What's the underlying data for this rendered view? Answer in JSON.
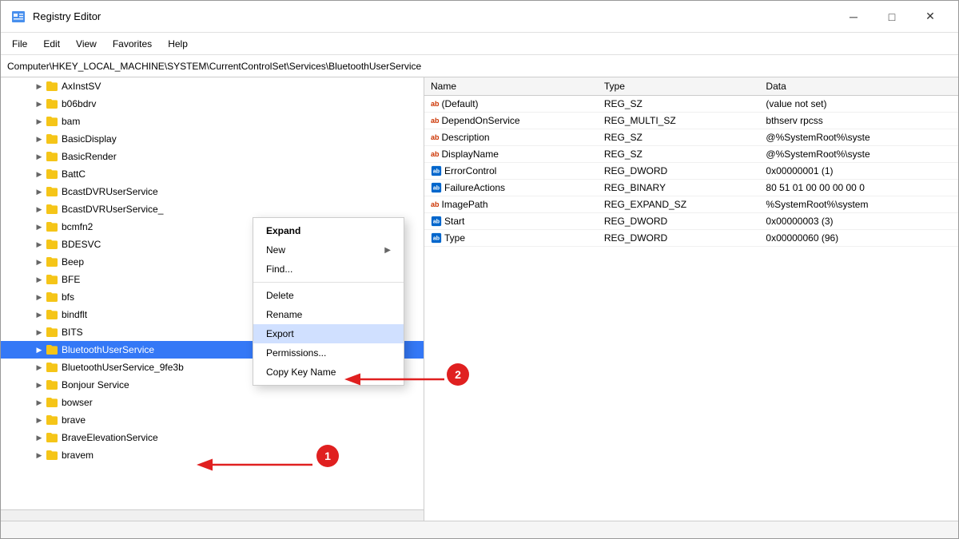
{
  "window": {
    "title": "Registry Editor",
    "app_icon": "🗂"
  },
  "window_controls": {
    "minimize": "─",
    "maximize": "□",
    "close": "✕"
  },
  "menu": {
    "items": [
      "File",
      "Edit",
      "View",
      "Favorites",
      "Help"
    ]
  },
  "address_bar": {
    "path": "Computer\\HKEY_LOCAL_MACHINE\\SYSTEM\\CurrentControlSet\\Services\\BluetoothUserService"
  },
  "tree": {
    "items": [
      {
        "label": "AxInstSV",
        "indent": 1,
        "selected": false
      },
      {
        "label": "b06bdrv",
        "indent": 1,
        "selected": false
      },
      {
        "label": "bam",
        "indent": 1,
        "selected": false
      },
      {
        "label": "BasicDisplay",
        "indent": 1,
        "selected": false
      },
      {
        "label": "BasicRender",
        "indent": 1,
        "selected": false
      },
      {
        "label": "BattC",
        "indent": 1,
        "selected": false
      },
      {
        "label": "BcastDVRUserService",
        "indent": 1,
        "selected": false
      },
      {
        "label": "BcastDVRUserService_",
        "indent": 1,
        "selected": false
      },
      {
        "label": "bcmfn2",
        "indent": 1,
        "selected": false
      },
      {
        "label": "BDESVC",
        "indent": 1,
        "selected": false
      },
      {
        "label": "Beep",
        "indent": 1,
        "selected": false
      },
      {
        "label": "BFE",
        "indent": 1,
        "selected": false
      },
      {
        "label": "bfs",
        "indent": 1,
        "selected": false
      },
      {
        "label": "bindflt",
        "indent": 1,
        "selected": false
      },
      {
        "label": "BITS",
        "indent": 1,
        "selected": false
      },
      {
        "label": "BluetoothUserService",
        "indent": 1,
        "selected": true
      },
      {
        "label": "BluetoothUserService_9fe3b",
        "indent": 1,
        "selected": false
      },
      {
        "label": "Bonjour Service",
        "indent": 1,
        "selected": false
      },
      {
        "label": "bowser",
        "indent": 1,
        "selected": false
      },
      {
        "label": "brave",
        "indent": 1,
        "selected": false
      },
      {
        "label": "BraveElevationService",
        "indent": 1,
        "selected": false
      },
      {
        "label": "bravem",
        "indent": 1,
        "selected": false
      }
    ]
  },
  "context_menu": {
    "items": [
      {
        "label": "Expand",
        "bold": true,
        "has_arrow": false,
        "separator_after": false
      },
      {
        "label": "New",
        "bold": false,
        "has_arrow": true,
        "separator_after": false
      },
      {
        "label": "Find...",
        "bold": false,
        "has_arrow": false,
        "separator_after": true
      },
      {
        "label": "Delete",
        "bold": false,
        "has_arrow": false,
        "separator_after": false
      },
      {
        "label": "Rename",
        "bold": false,
        "has_arrow": false,
        "separator_after": false
      },
      {
        "label": "Export",
        "bold": false,
        "has_arrow": false,
        "separator_after": false,
        "highlighted": true
      },
      {
        "label": "Permissions...",
        "bold": false,
        "has_arrow": false,
        "separator_after": false
      },
      {
        "label": "Copy Key Name",
        "bold": false,
        "has_arrow": false,
        "separator_after": false
      }
    ]
  },
  "registry_table": {
    "columns": [
      "Name",
      "Type",
      "Data"
    ],
    "rows": [
      {
        "icon": "ab",
        "name": "(Default)",
        "type": "REG_SZ",
        "data": "(value not set)"
      },
      {
        "icon": "ab",
        "name": "DependOnService",
        "type": "REG_MULTI_SZ",
        "data": "bthserv rpcss"
      },
      {
        "icon": "ab",
        "name": "Description",
        "type": "REG_SZ",
        "data": "@%SystemRoot%\\syste"
      },
      {
        "icon": "ab",
        "name": "DisplayName",
        "type": "REG_SZ",
        "data": "@%SystemRoot%\\syste"
      },
      {
        "icon": "dword",
        "name": "ErrorControl",
        "type": "REG_DWORD",
        "data": "0x00000001 (1)"
      },
      {
        "icon": "dword",
        "name": "FailureActions",
        "type": "REG_BINARY",
        "data": "80 51 01 00 00 00 00 0"
      },
      {
        "icon": "ab",
        "name": "ImagePath",
        "type": "REG_EXPAND_SZ",
        "data": "%SystemRoot%\\system"
      },
      {
        "icon": "dword",
        "name": "Start",
        "type": "REG_DWORD",
        "data": "0x00000003 (3)"
      },
      {
        "icon": "dword",
        "name": "Type",
        "type": "REG_DWORD",
        "data": "0x00000060 (96)"
      }
    ]
  },
  "annotations": {
    "circle1_label": "1",
    "circle2_label": "2"
  }
}
